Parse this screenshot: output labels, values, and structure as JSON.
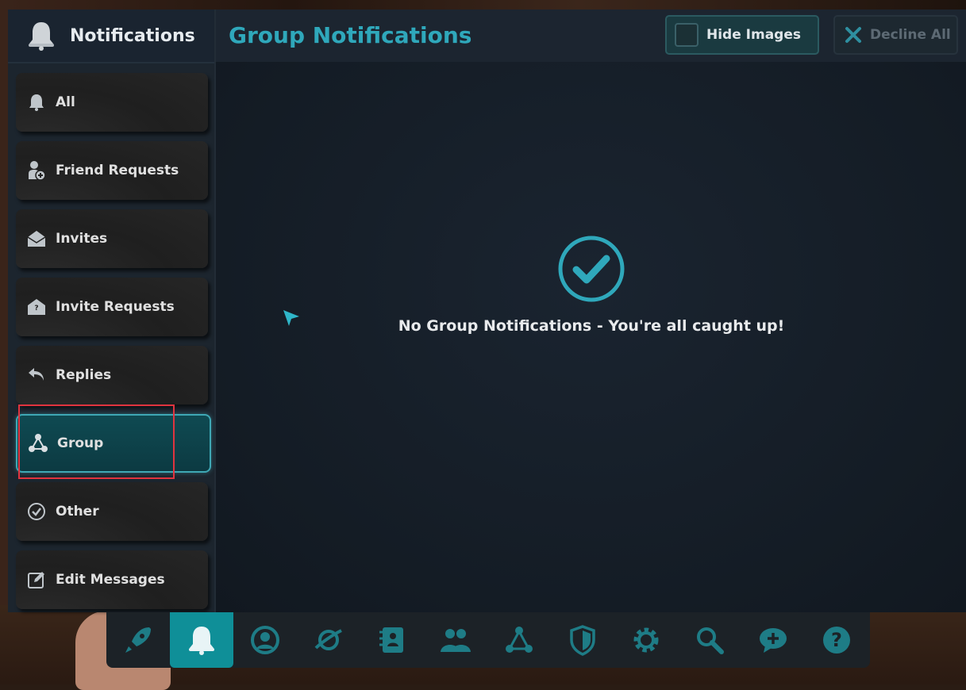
{
  "sidebar": {
    "title": "Notifications",
    "items": [
      {
        "label": "All",
        "icon": "bell-icon"
      },
      {
        "label": "Friend Requests",
        "icon": "add-person-icon"
      },
      {
        "label": "Invites",
        "icon": "envelope-open-icon"
      },
      {
        "label": "Invite Requests",
        "icon": "envelope-question-icon"
      },
      {
        "label": "Replies",
        "icon": "reply-icon"
      },
      {
        "label": "Group",
        "icon": "group-nodes-icon",
        "active": true
      },
      {
        "label": "Other",
        "icon": "check-circle-icon"
      },
      {
        "label": "Edit Messages",
        "icon": "edit-icon"
      }
    ]
  },
  "main": {
    "title": "Group Notifications",
    "hide_images_label": "Hide Images",
    "decline_all_label": "Decline All",
    "empty_message": "No Group Notifications - You're all caught up!"
  },
  "toolbar": {
    "buttons": [
      "rocket-icon",
      "bell-icon",
      "profile-icon",
      "planet-icon",
      "journal-icon",
      "people-icon",
      "group-nodes-icon",
      "shield-icon",
      "gear-icon",
      "search-icon",
      "chat-plus-icon",
      "help-icon"
    ],
    "active": "bell-icon"
  },
  "colors": {
    "accent": "#2fa8bb",
    "active_nav": "#0f4a52",
    "toolbar_active": "#0f8f98"
  }
}
